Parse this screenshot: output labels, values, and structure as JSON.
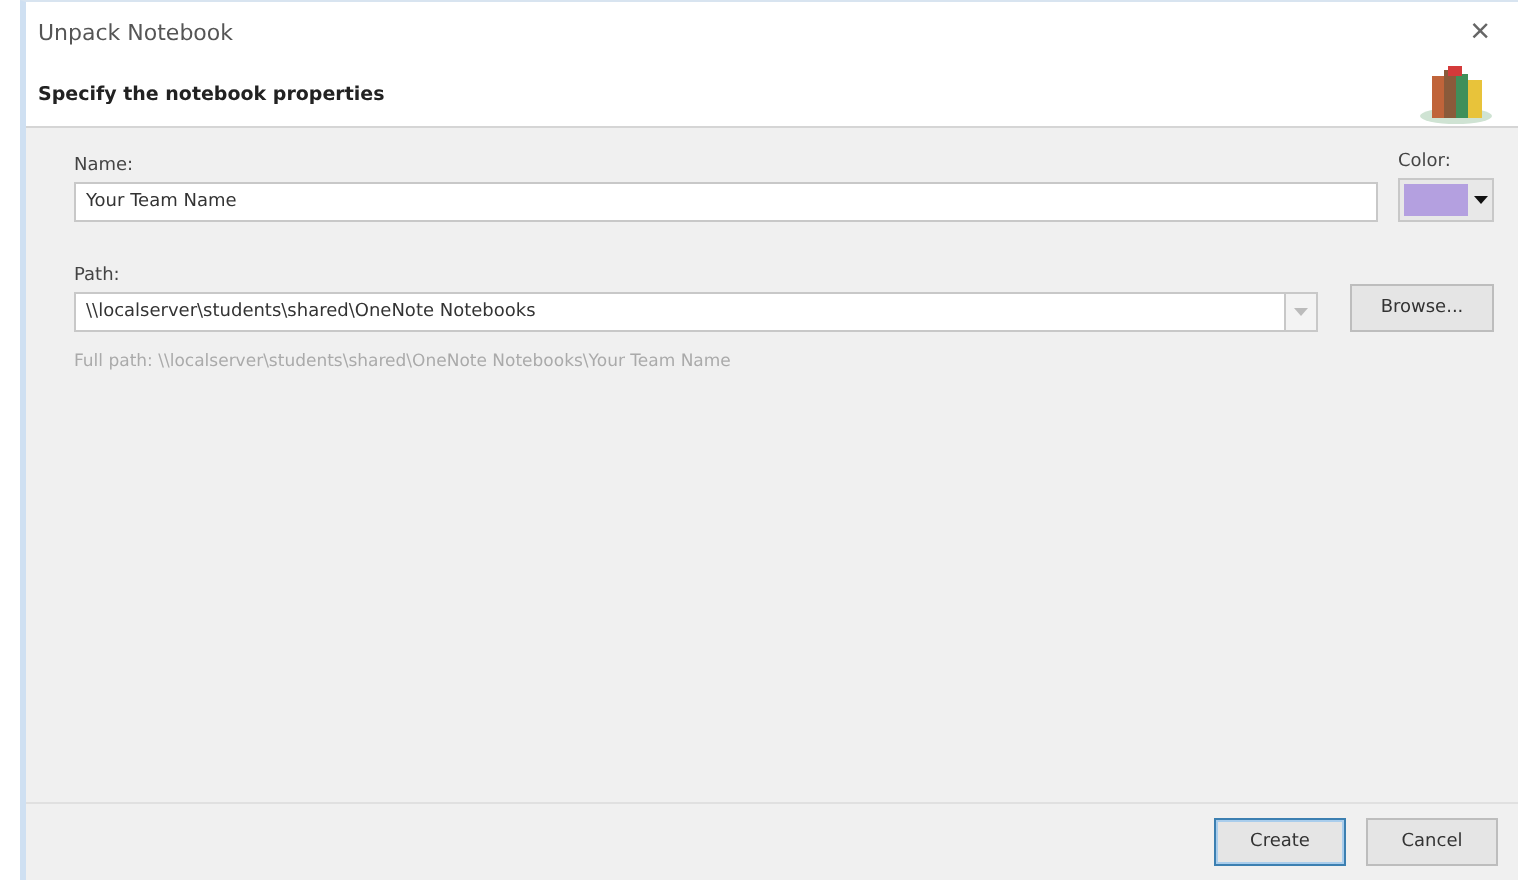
{
  "window": {
    "title": "Unpack Notebook",
    "close": "×"
  },
  "header": {
    "heading": "Specify the notebook properties"
  },
  "name_field": {
    "label": "Name:",
    "value": "Your Team Name"
  },
  "color_picker": {
    "label": "Color:",
    "color": "#b4a0e0"
  },
  "path_field": {
    "label": "Path:",
    "value": "\\\\localserver\\students\\shared\\OneNote Notebooks"
  },
  "browse_button": "Browse...",
  "full_path": "Full path: \\\\localserver\\students\\shared\\OneNote Notebooks\\Your Team Name",
  "buttons": [
    {
      "label": "Create",
      "default": true
    },
    {
      "label": "Cancel",
      "default": false
    }
  ]
}
